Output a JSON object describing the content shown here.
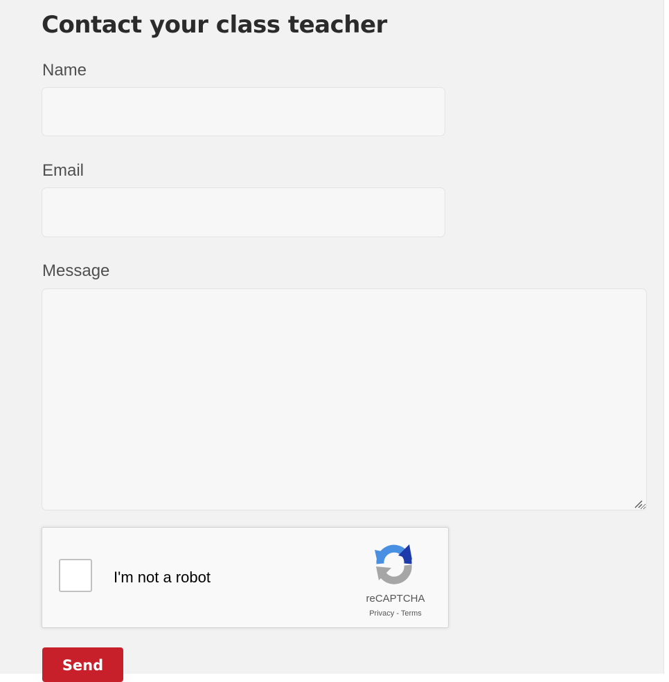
{
  "form": {
    "title": "Contact your class teacher",
    "name_label": "Name",
    "name_value": "",
    "email_label": "Email",
    "email_value": "",
    "message_label": "Message",
    "message_value": "",
    "send_label": "Send",
    "accent_color": "#c8202a"
  },
  "recaptcha": {
    "checkbox_label": "I'm not a robot",
    "checked": false,
    "brand": "reCAPTCHA",
    "privacy_label": "Privacy",
    "separator": " - ",
    "terms_label": "Terms",
    "logo_icon": "recaptcha-logo-icon"
  }
}
